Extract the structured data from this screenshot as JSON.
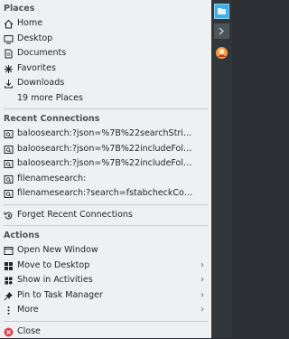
{
  "places": {
    "heading": "Places",
    "items": [
      {
        "label": "Home",
        "icon": "home-icon"
      },
      {
        "label": "Desktop",
        "icon": "desktop-icon"
      },
      {
        "label": "Documents",
        "icon": "documents-icon"
      },
      {
        "label": "Favorites",
        "icon": "star-icon"
      },
      {
        "label": "Downloads",
        "icon": "download-icon"
      }
    ],
    "more": "19 more Places"
  },
  "recent": {
    "heading": "Recent Connections",
    "items": [
      {
        "label": "baloosearch:?json=%7B%22searchString%22:%...",
        "icon": "search-file-icon"
      },
      {
        "label": "baloosearch:?json=%7B%22includeFolder%22:...",
        "icon": "search-file-icon"
      },
      {
        "label": "baloosearch:?json=%7B%22includeFolder%22:...",
        "icon": "search-file-icon"
      },
      {
        "label": "filenamesearch:",
        "icon": "search-file-icon"
      },
      {
        "label": "filenamesearch:?search=fstabcheckContent=...",
        "icon": "search-file-icon"
      }
    ],
    "forget": "Forget Recent Connections"
  },
  "actions": {
    "heading": "Actions",
    "items": [
      {
        "label": "Open New Window",
        "icon": "window-icon"
      },
      {
        "label": "Move to Desktop",
        "icon": "grid-icon"
      },
      {
        "label": "Show in Activities",
        "icon": "activities-icon"
      },
      {
        "label": "Pin to Task Manager",
        "icon": "pin-icon"
      },
      {
        "label": "More",
        "icon": "more-icon"
      }
    ],
    "close": "Close"
  },
  "colors": {
    "accent": "#3daee9",
    "close": "#da4453",
    "panel": "#31363b",
    "menu_bg": "#eff0f1"
  }
}
